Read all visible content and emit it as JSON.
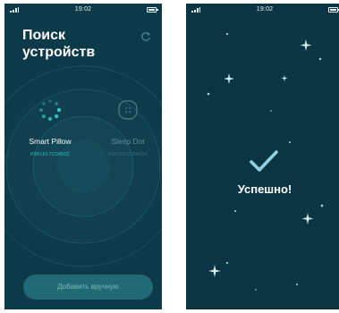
{
  "status_bar": {
    "time": "19:02"
  },
  "search_screen": {
    "title": "Поиск\nустройств",
    "devices": [
      {
        "name": "Smart Pillow",
        "id": "P201617C04502",
        "state": "searching"
      },
      {
        "name": "Sleep Dot",
        "id": "P201617C04502",
        "state": "inactive"
      }
    ],
    "add_button_label": "Добавить вручную",
    "icons": {
      "refresh": "refresh-icon",
      "pillow": "spinner-icon",
      "sleep_dot": "sleep-dot-icon"
    }
  },
  "success_screen": {
    "message": "Успешно!",
    "icons": {
      "check": "check-icon"
    }
  },
  "colors": {
    "background": "#0d3a49",
    "accent": "#2fc9c4",
    "button": "#1f6a74",
    "check": "#8fd3e0",
    "muted_text": "#5d8b98"
  }
}
